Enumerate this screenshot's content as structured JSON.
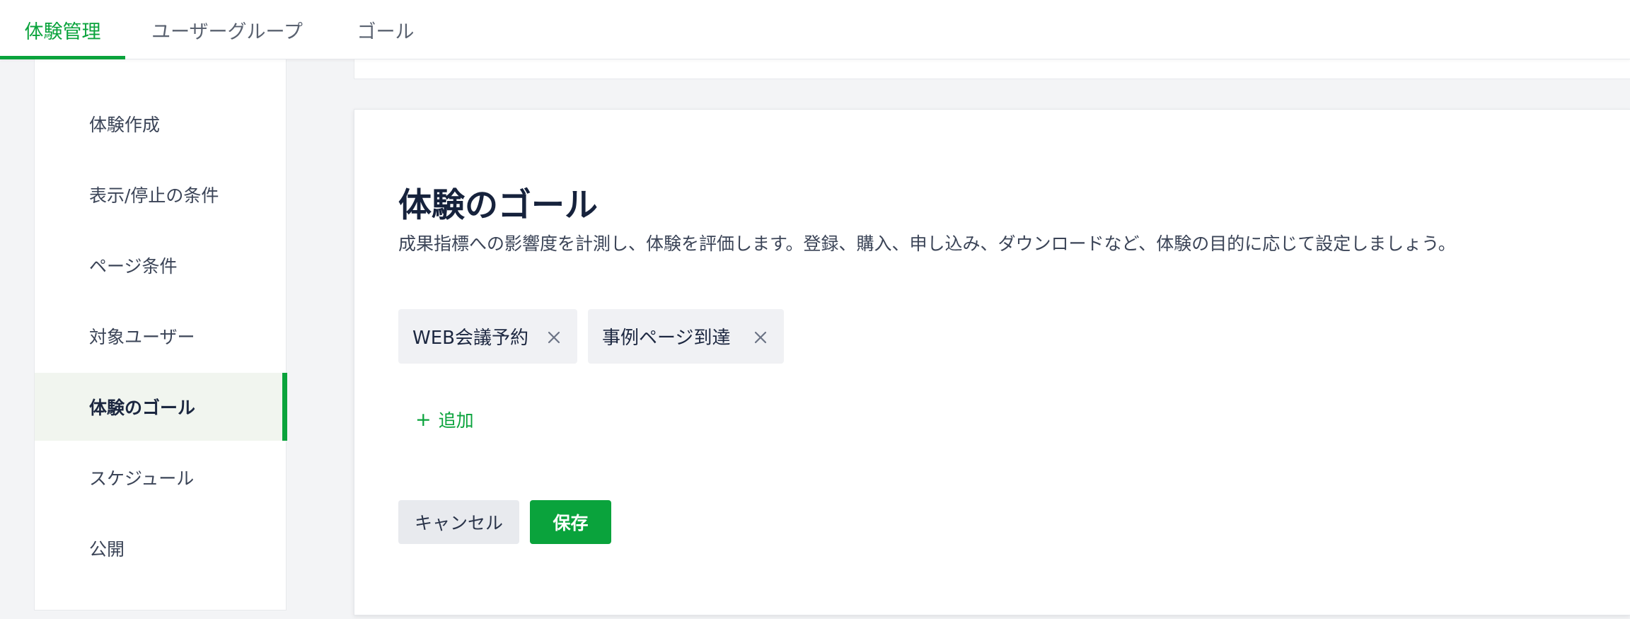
{
  "tabs": [
    {
      "label": "体験管理",
      "active": true
    },
    {
      "label": "ユーザーグループ",
      "active": false
    },
    {
      "label": "ゴール",
      "active": false
    }
  ],
  "sidebar": {
    "items": [
      {
        "label": "体験作成"
      },
      {
        "label": "表示/停止の条件"
      },
      {
        "label": "ページ条件"
      },
      {
        "label": "対象ユーザー"
      },
      {
        "label": "体験のゴール",
        "active": true
      },
      {
        "label": "スケジュール"
      },
      {
        "label": "公開"
      }
    ]
  },
  "card": {
    "title": "体験のゴール",
    "description": "成果指標への影響度を計測し、体験を評価します。登録、購入、申し込み、ダウンロードなど、体験の目的に応じて設定しましょう。",
    "chips": [
      {
        "label": "WEB会議予約"
      },
      {
        "label": "事例ページ到達"
      }
    ],
    "add_label": "追加",
    "cancel_label": "キャンセル",
    "save_label": "保存"
  },
  "colors": {
    "accent": "#0aa33c",
    "background": "#f3f4f6",
    "text": "#1f2a44"
  }
}
